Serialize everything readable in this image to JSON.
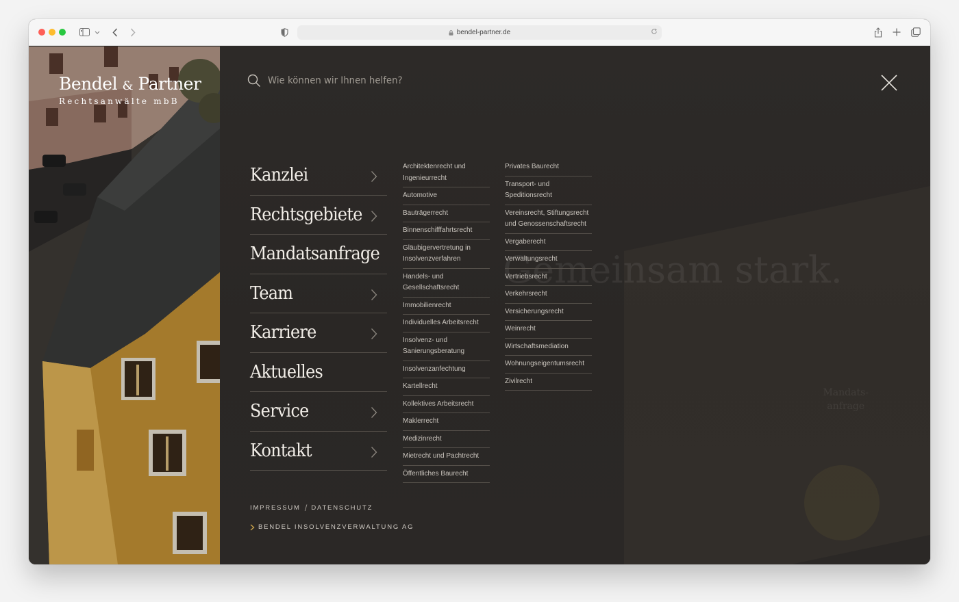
{
  "browser": {
    "url": "bendel-partner.de"
  },
  "logo": {
    "main": "Bendel",
    "amp": "&",
    "partner": "Partner",
    "sub": "Rechtsanwälte mbB"
  },
  "search": {
    "placeholder": "Wie können wir Ihnen helfen?"
  },
  "main_nav": [
    {
      "label": "Kanzlei",
      "has_arrow": true
    },
    {
      "label": "Rechtsgebiete",
      "has_arrow": true
    },
    {
      "label": "Mandatsanfrage",
      "has_arrow": false
    },
    {
      "label": "Team",
      "has_arrow": true
    },
    {
      "label": "Karriere",
      "has_arrow": true
    },
    {
      "label": "Aktuelles",
      "has_arrow": false
    },
    {
      "label": "Service",
      "has_arrow": true
    },
    {
      "label": "Kontakt",
      "has_arrow": true
    }
  ],
  "footer": {
    "impressum": "IMPRESSUM",
    "slash": "/",
    "datenschutz": "DATENSCHUTZ",
    "insolvenz_link": "BENDEL INSOLVENZVERWALTUNG AG"
  },
  "background": {
    "slogan": "Gemeinsam stark.",
    "cta_line1": "Mandats-",
    "cta_line2": "anfrage"
  },
  "rechtsgebiete_col1": [
    "Architektenrecht und Ingenieurrecht",
    "Automotive",
    "Bauträgerrecht",
    "Binnenschifffahrtsrecht",
    "Gläubigervertretung in Insolvenzverfahren",
    "Handels- und Gesellschaftsrecht",
    "Immobilienrecht",
    "Individuelles Arbeitsrecht",
    "Insolvenz- und Sanierungsberatung",
    "Insolvenzanfechtung",
    "Kartellrecht",
    "Kollektives Arbeitsrecht",
    "Maklerrecht",
    "Medizinrecht",
    "Mietrecht und Pachtrecht",
    "Öffentliches Baurecht"
  ],
  "rechtsgebiete_col2": [
    "Privates Baurecht",
    "Transport- und Speditionsrecht",
    "Vereinsrecht, Stiftungsrecht und Genossenschaftsrecht",
    "Vergaberecht",
    "Verwaltungsrecht",
    "Vertriebsrecht",
    "Verkehrsrecht",
    "Versicherungsrecht",
    "Weinrecht",
    "Wirtschaftsmediation",
    "Wohnungseigentumsrecht",
    "Zivilrecht"
  ]
}
